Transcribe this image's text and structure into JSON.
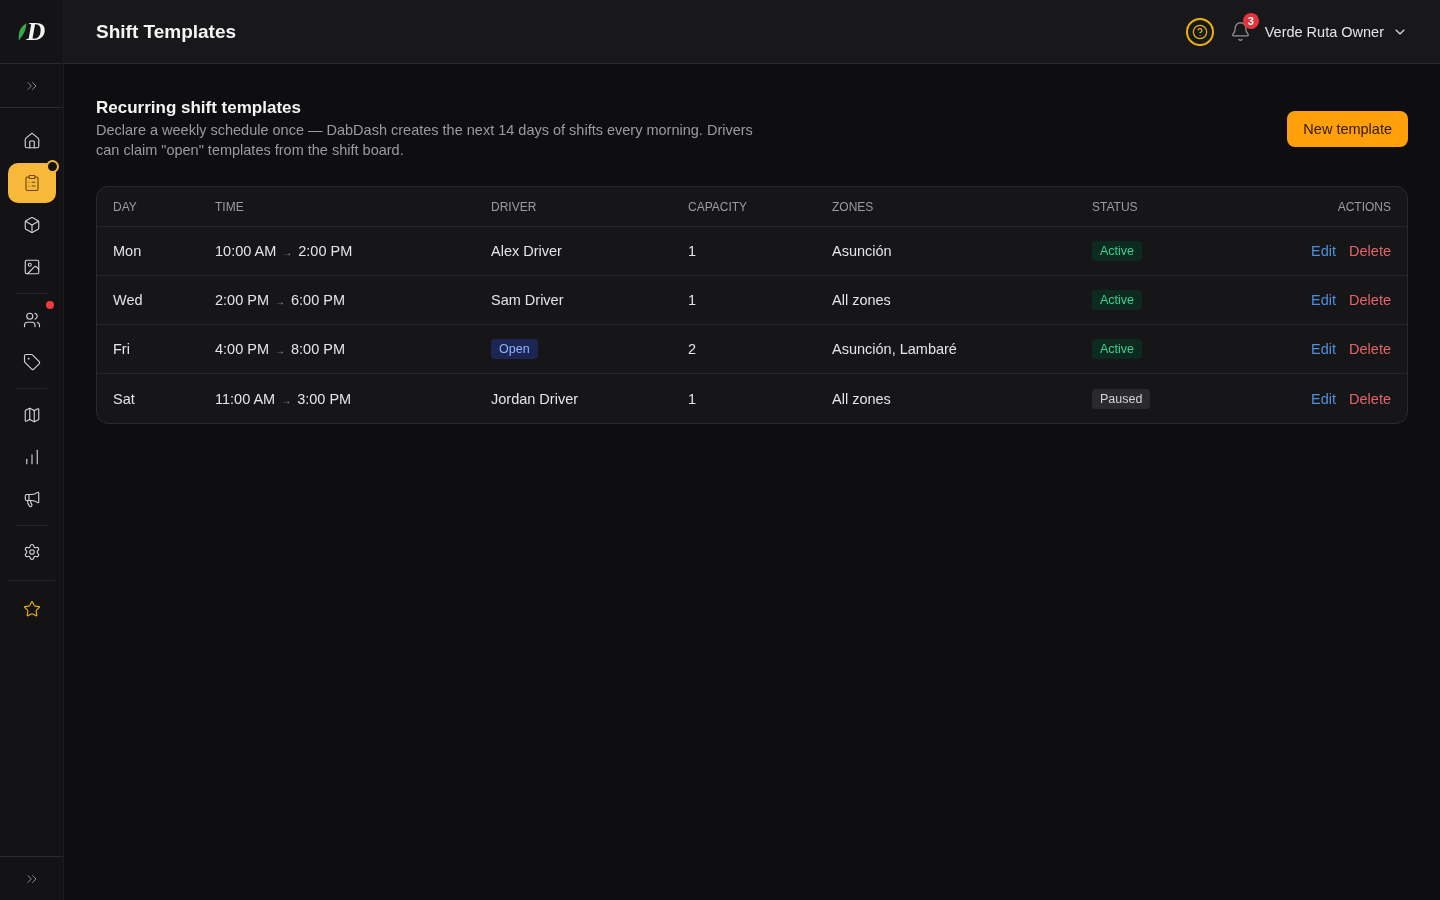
{
  "brand": {
    "mark": "D"
  },
  "sidebar": {
    "groups": [
      [
        {
          "selected": false,
          "badge": false
        },
        {
          "selected": true,
          "badge": true
        },
        {
          "selected": false,
          "badge": false
        },
        {
          "selected": false,
          "badge": false
        }
      ],
      [
        {
          "selected": false,
          "badge": true
        },
        {
          "selected": false,
          "badge": false
        }
      ],
      [
        {
          "selected": false,
          "badge": false
        },
        {
          "selected": false,
          "badge": false
        },
        {
          "selected": false,
          "badge": false
        }
      ],
      [
        {
          "selected": false,
          "badge": false
        }
      ],
      [
        {
          "selected": false,
          "badge": false
        }
      ]
    ]
  },
  "header": {
    "title": "Shift Templates",
    "notifications": {
      "count": "3"
    },
    "user": {
      "name": "Verde Ruta Owner"
    }
  },
  "section": {
    "title": "Recurring shift templates",
    "description": "Declare a weekly schedule once — DabDash creates the next 14 days of shifts every morning. Drivers can claim \"open\" templates from the shift board.",
    "primary_button": "New template"
  },
  "table": {
    "columns": [
      "DAY",
      "TIME",
      "DRIVER",
      "CAPACITY",
      "ZONES",
      "STATUS",
      "ACTIONS"
    ],
    "rows": [
      {
        "day": "Mon",
        "time": {
          "start": "10:00 AM",
          "separator": "→",
          "end": "2:00 PM"
        },
        "driver": {
          "kind": "assigned",
          "name": "Alex Driver"
        },
        "capacity": "1",
        "zones": "Asunción",
        "status": {
          "kind": "active",
          "label": "Active"
        },
        "actions": [
          {
            "kind": "edit",
            "label": "Edit"
          },
          {
            "kind": "danger",
            "label": "Delete"
          }
        ]
      },
      {
        "day": "Wed",
        "time": {
          "start": "2:00 PM",
          "separator": "→",
          "end": "6:00 PM"
        },
        "driver": {
          "kind": "assigned",
          "name": "Sam Driver"
        },
        "capacity": "1",
        "zones": "All zones",
        "status": {
          "kind": "active",
          "label": "Active"
        },
        "actions": [
          {
            "kind": "edit",
            "label": "Edit"
          },
          {
            "kind": "danger",
            "label": "Delete"
          }
        ]
      },
      {
        "day": "Fri",
        "time": {
          "start": "4:00 PM",
          "separator": "→",
          "end": "8:00 PM"
        },
        "driver": {
          "kind": "open",
          "name": "Open"
        },
        "capacity": "2",
        "zones": "Asunción, Lambaré",
        "status": {
          "kind": "active",
          "label": "Active"
        },
        "actions": [
          {
            "kind": "edit",
            "label": "Edit"
          },
          {
            "kind": "danger",
            "label": "Delete"
          }
        ]
      },
      {
        "day": "Sat",
        "time": {
          "start": "11:00 AM",
          "separator": "→",
          "end": "3:00 PM"
        },
        "driver": {
          "kind": "assigned",
          "name": "Jordan Driver"
        },
        "capacity": "1",
        "zones": "All zones",
        "status": {
          "kind": "paused",
          "label": "Paused"
        },
        "actions": [
          {
            "kind": "edit",
            "label": "Edit"
          },
          {
            "kind": "danger",
            "label": "Delete"
          }
        ]
      }
    ]
  }
}
